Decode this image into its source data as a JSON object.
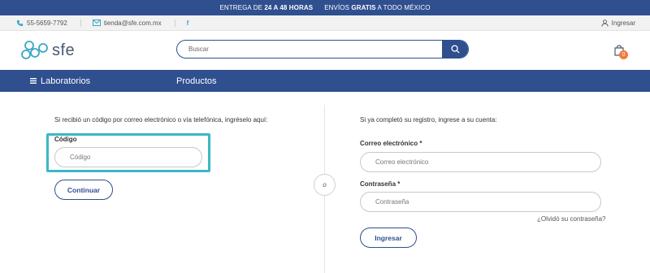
{
  "promo": {
    "part1": "ENTREGA DE",
    "part1_bold": "24 A 48 HORAS",
    "part2": "ENVÍOS",
    "part2_bold": "GRATIS",
    "part3": "A TODO MÉXICO"
  },
  "contact": {
    "phone": "55-5659-7792",
    "email": "tienda@sfe.com.mx",
    "facebook": "f",
    "login": "Ingresar"
  },
  "header": {
    "logo_text": "sfe",
    "search_placeholder": "Buscar",
    "cart_count": "0"
  },
  "nav": {
    "categories": "Laboratorios",
    "products": "Productos"
  },
  "code_section": {
    "title": "Si recibió un código por correo electrónico o vía telefónica, ingréselo aquí:",
    "label": "Código",
    "placeholder": "Código",
    "button": "Continuar"
  },
  "or_label": "o",
  "login_section": {
    "title": "Si ya completó su registro, ingrese a su cuenta:",
    "email_label": "Correo electrónico *",
    "email_placeholder": "Correo electrónico",
    "password_label": "Contraseña *",
    "password_placeholder": "Contraseña",
    "forgot": "¿Olvidó su contraseña?",
    "button": "Ingresar"
  },
  "colors": {
    "brand_blue": "#2f4f8f",
    "highlight_teal": "#3bb8c4",
    "badge_orange": "#f47b3a"
  }
}
